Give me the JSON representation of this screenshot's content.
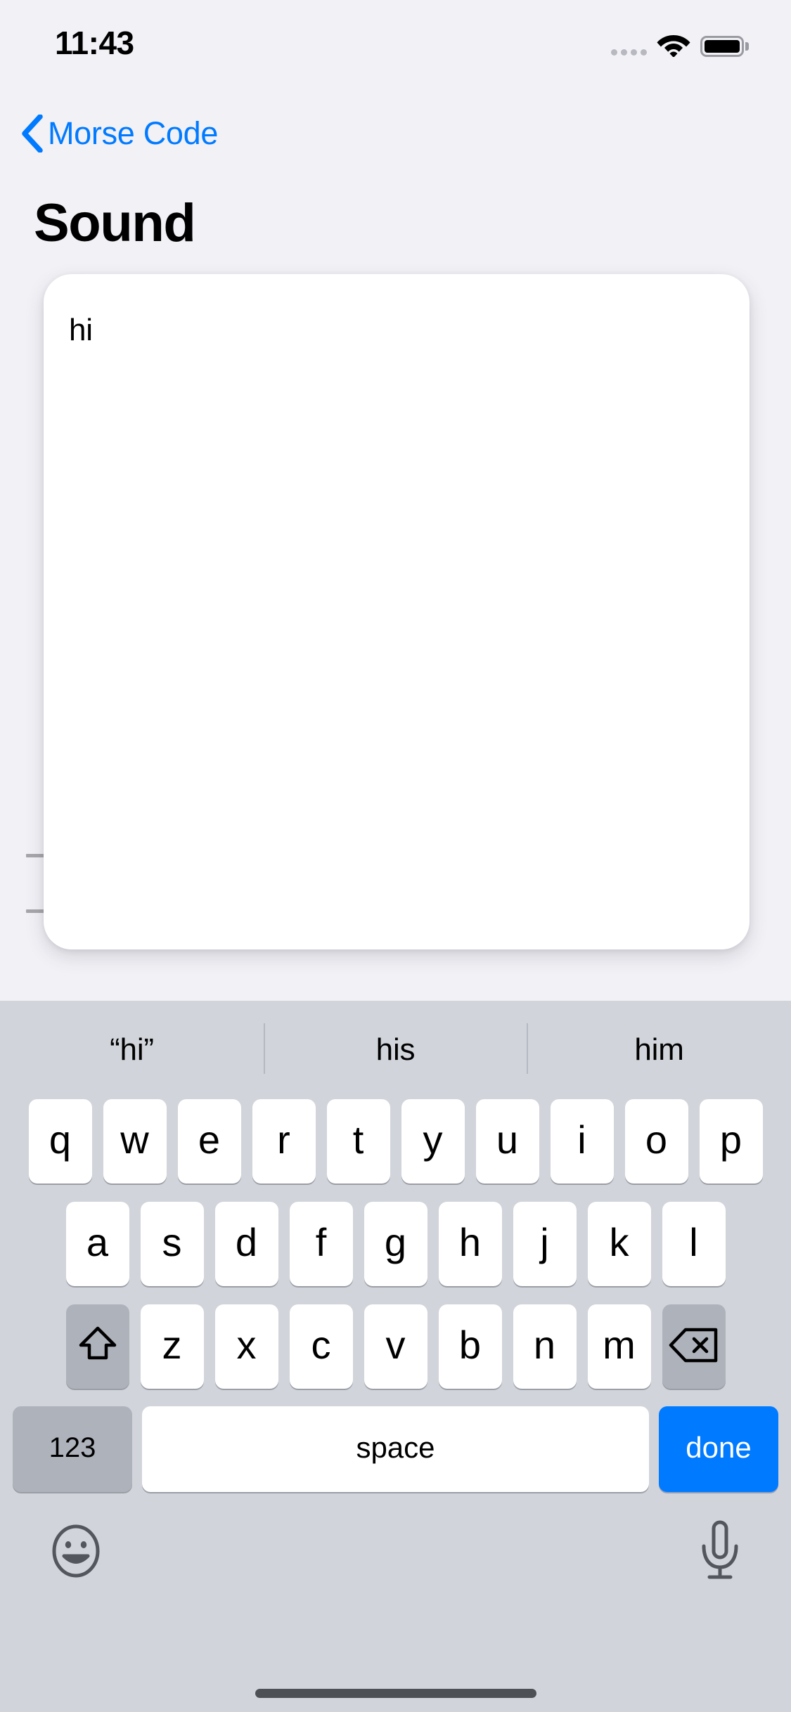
{
  "status_bar": {
    "time": "11:43",
    "icons": {
      "cellular": "cellular-dots-icon",
      "wifi": "wifi-icon",
      "battery": "battery-full-icon"
    }
  },
  "nav": {
    "back_icon": "chevron-left-icon",
    "back_label": "Morse Code"
  },
  "page": {
    "title": "Sound"
  },
  "editor": {
    "value": "hi",
    "placeholder": ""
  },
  "keyboard": {
    "predictions": [
      "“hi”",
      "his",
      "him"
    ],
    "row1": [
      "q",
      "w",
      "e",
      "r",
      "t",
      "y",
      "u",
      "i",
      "o",
      "p"
    ],
    "row2": [
      "a",
      "s",
      "d",
      "f",
      "g",
      "h",
      "j",
      "k",
      "l"
    ],
    "row3": [
      "z",
      "x",
      "c",
      "v",
      "b",
      "n",
      "m"
    ],
    "shift_icon": "shift-arrow-up-icon",
    "delete_icon": "backspace-delete-icon",
    "numeric_label": "123",
    "space_label": "space",
    "return_label": "done",
    "emoji_icon": "smiley-face-icon",
    "dictation_icon": "microphone-icon"
  },
  "colors": {
    "accent": "#007aff",
    "background": "#f1f1f6",
    "keyboard_bg": "#d1d4da",
    "key_bg": "#ffffff",
    "key_mod_bg": "#aeb2bb"
  }
}
